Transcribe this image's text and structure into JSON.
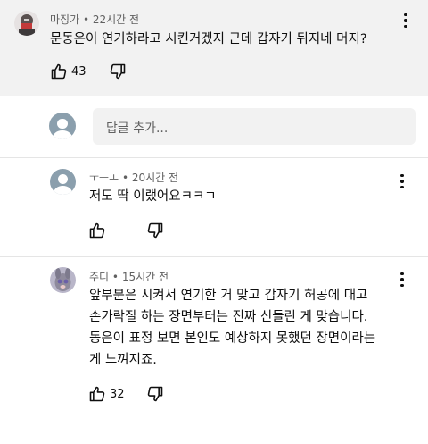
{
  "comment_top": {
    "author": "마징가",
    "time": "22시간 전",
    "text": "문동은이 연기하라고 시킨거겠지 근데 갑자기 뒤지네 머지?",
    "like_count": "43"
  },
  "reply_box": {
    "placeholder": "답글 추가..."
  },
  "reply_1": {
    "author": "ㅜㅡㅗ",
    "time": "20시간 전",
    "text": "저도 딱 이랬어요ㅋㅋㄱ"
  },
  "reply_2": {
    "author": "주디",
    "time": "15시간 전",
    "lines": [
      "앞부분은 시켜서 연기한 거 맞고 갑자기 허공에 대고",
      "손가락질 하는 장면부터는 진짜 신들린 게 맞습니다.",
      "동은이 표정 보면 본인도 예상하지 못했던 장면이라는",
      "게 느껴지죠."
    ],
    "like_count": "32"
  },
  "meta_separator": " • ",
  "colors": {
    "highlight_bg": "#f2f2f2",
    "meta": "#606060",
    "text": "#0f0f0f",
    "default_avatar": "#8b9fad"
  },
  "icons": {
    "like": "thumbs-up-icon",
    "dislike": "thumbs-down-icon",
    "menu": "more-vert-icon",
    "default_avatar": "user-silhouette-icon"
  }
}
